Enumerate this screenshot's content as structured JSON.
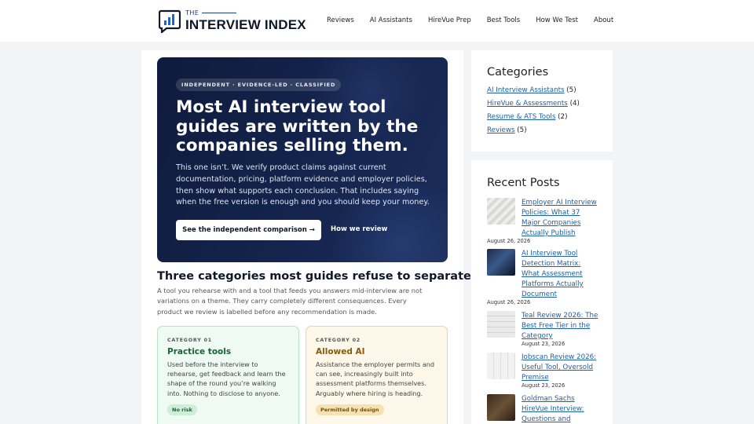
{
  "header": {
    "logo_the": "THE",
    "logo_main": "INTERVIEW INDEX",
    "nav": [
      "Reviews",
      "AI Assistants",
      "HireVue Prep",
      "Best Tools",
      "How We Test",
      "About"
    ]
  },
  "hero": {
    "badge": "INDEPENDENT · EVIDENCE-LED · CLASSIFIED",
    "title": "Most AI interview tool guides are written by the companies selling them.",
    "description": "This one isn’t. We verify product claims against current documentation, pricing, platform evidence and employer policies, then show what supports each conclusion. That includes saying when the free version is enough and you should keep your money.",
    "primary_button": "See the independent comparison →",
    "secondary_link": "How we review"
  },
  "section": {
    "title": "Three categories most guides refuse to separate",
    "description": "A tool you rehearse with and a tool that feeds you answers mid-interview are not variations on a theme. They carry completely different consequences. Every product we review is labelled before any recommendation is made."
  },
  "categories_cards": [
    {
      "label": "CATEGORY 01",
      "title": "Practice tools",
      "description": "Used before the interview to rehearse, get feedback and learn the shape of the round you’re walking into. Nothing to disclose to anyone.",
      "pill": "No risk",
      "color": "#166534"
    },
    {
      "label": "CATEGORY 02",
      "title": "Allowed AI",
      "description": "Assistance the employer permits and can see, increasingly built into assessment platforms themselves. Arguably where hiring is heading.",
      "pill": "Permitted by design",
      "color": "#8a5a0b"
    }
  ],
  "sidebar": {
    "categories_title": "Categories",
    "categories": [
      {
        "name": "AI Interview Assistants",
        "count": "(5)"
      },
      {
        "name": "HireVue & Assessments",
        "count": "(4)"
      },
      {
        "name": "Resume & ATS Tools",
        "count": "(2)"
      },
      {
        "name": "Reviews",
        "count": "(5)"
      }
    ],
    "recent_title": "Recent Posts",
    "posts": [
      {
        "title": "Employer AI Interview Policies: What 37 Major Companies Actually Publish",
        "date": "August 26, 2026"
      },
      {
        "title": "AI Interview Tool Detection Matrix: What Assessment Platforms Actually Document",
        "date": "August 26, 2026"
      },
      {
        "title": "Teal Review 2026: The Best Free Tier in the Category",
        "date": "August 23, 2026"
      },
      {
        "title": "Jobscan Review 2026: Useful Tool, Oversold Premise",
        "date": "August 23, 2026"
      },
      {
        "title": "Goldman Sachs HireVue Interview: Questions and",
        "date": ""
      }
    ]
  },
  "colors": {
    "brand_navy": "#0f172a",
    "hero_bg": "#14244d",
    "link": "#1d5fa8"
  }
}
